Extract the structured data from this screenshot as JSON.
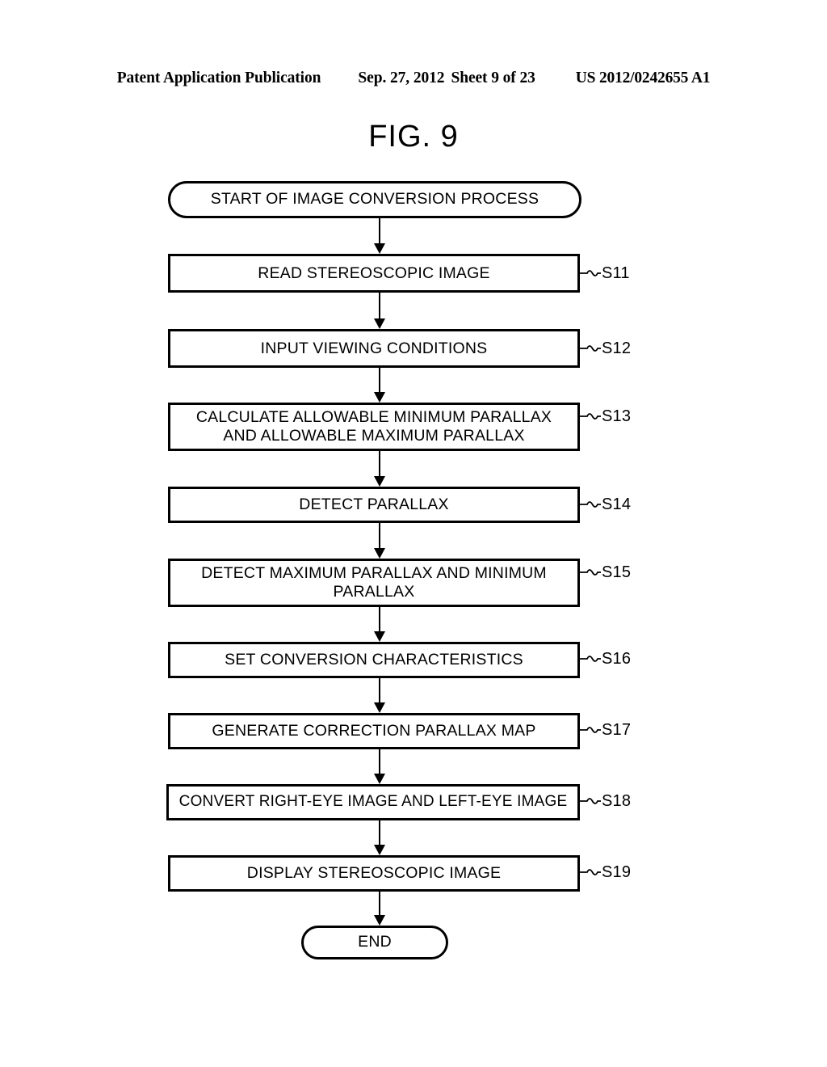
{
  "header": {
    "publication": "Patent Application Publication",
    "date": "Sep. 27, 2012",
    "sheet": "Sheet 9 of 23",
    "pub_number": "US 2012/0242655 A1"
  },
  "figure": {
    "title": "FIG. 9"
  },
  "flowchart": {
    "start": {
      "label": "START OF IMAGE CONVERSION PROCESS"
    },
    "end": {
      "label": "END"
    },
    "steps": [
      {
        "id": "S11",
        "line1": "READ STEREOSCOPIC IMAGE",
        "line2": ""
      },
      {
        "id": "S12",
        "line1": "INPUT VIEWING CONDITIONS",
        "line2": ""
      },
      {
        "id": "S13",
        "line1": "CALCULATE ALLOWABLE MINIMUM PARALLAX",
        "line2": "AND ALLOWABLE MAXIMUM PARALLAX"
      },
      {
        "id": "S14",
        "line1": "DETECT PARALLAX",
        "line2": ""
      },
      {
        "id": "S15",
        "line1": "DETECT MAXIMUM PARALLAX AND MINIMUM",
        "line2": "PARALLAX"
      },
      {
        "id": "S16",
        "line1": "SET CONVERSION CHARACTERISTICS",
        "line2": ""
      },
      {
        "id": "S17",
        "line1": "GENERATE CORRECTION PARALLAX MAP",
        "line2": ""
      },
      {
        "id": "S18",
        "line1": "CONVERT RIGHT-EYE IMAGE AND LEFT-EYE IMAGE",
        "line2": ""
      },
      {
        "id": "S19",
        "line1": "DISPLAY STEREOSCOPIC IMAGE",
        "line2": ""
      }
    ]
  },
  "colors": {
    "ink": "#000000",
    "page": "#ffffff"
  }
}
